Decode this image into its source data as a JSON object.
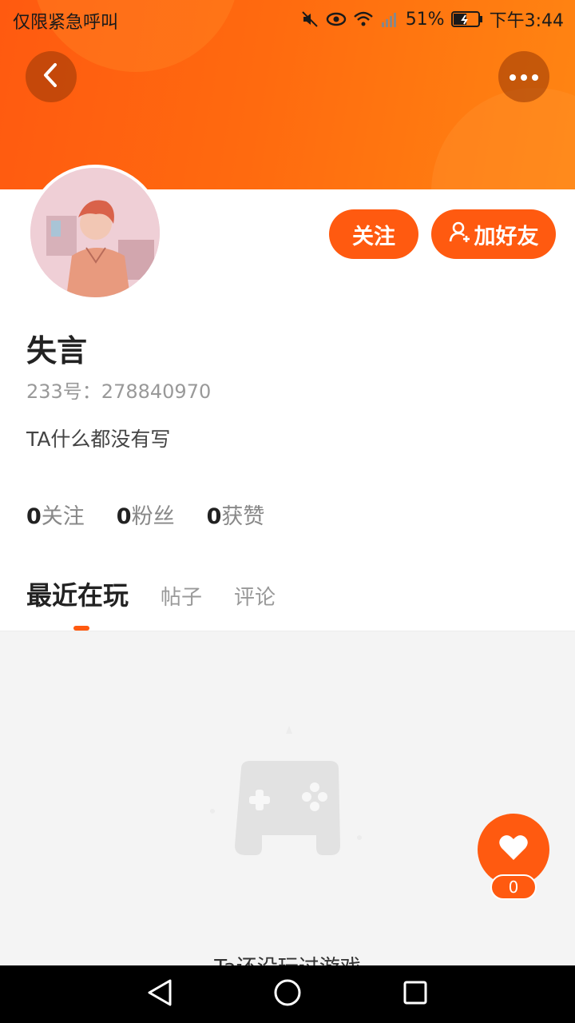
{
  "status_bar": {
    "left_text": "仅限紧急呼叫",
    "battery": "51%",
    "time": "下午3:44"
  },
  "header": {
    "back_icon": "chevron-left-icon",
    "more_icon": "more-dots-icon"
  },
  "profile": {
    "name": "失言",
    "id_line": "233号：278840970",
    "bio": "TA什么都没有写",
    "follow_label": "关注",
    "add_friend_label": "加好友"
  },
  "stats": [
    {
      "value": "0",
      "label": "关注"
    },
    {
      "value": "0",
      "label": "粉丝"
    },
    {
      "value": "0",
      "label": "获赞"
    }
  ],
  "tabs": {
    "active": "最近在玩",
    "posts": "帖子",
    "comments": "评论"
  },
  "empty_state": {
    "icon": "gamepad-icon",
    "text": "Ta还没玩过游戏"
  },
  "like": {
    "count": "0"
  },
  "colors": {
    "accent": "#ff5a10",
    "header_gradient_start": "#ff5a10",
    "header_gradient_end": "#ff8512"
  }
}
